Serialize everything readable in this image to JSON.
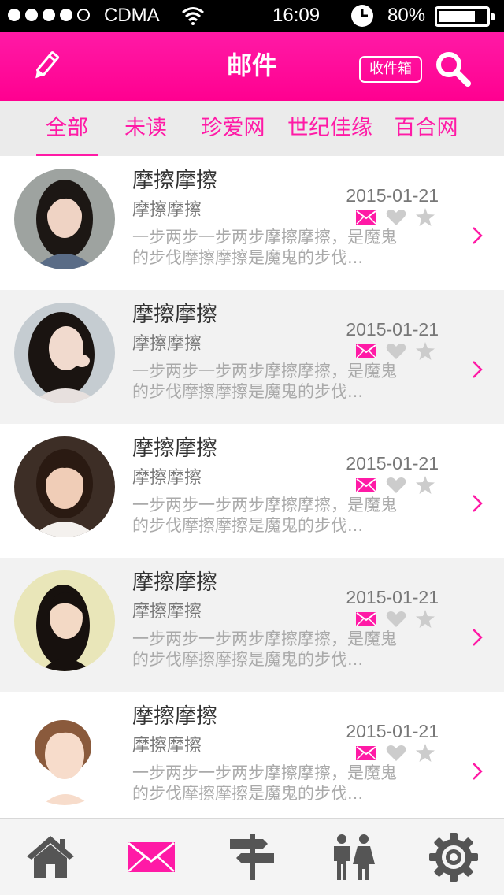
{
  "status_bar": {
    "carrier": "CDMA",
    "time": "16:09",
    "battery": "80%",
    "battery_level": 0.8,
    "signal_bars": 4
  },
  "header": {
    "title": "邮件",
    "inbox_label": "收件箱",
    "edit_icon": "pencil-icon",
    "search_icon": "search-icon"
  },
  "tabs": [
    {
      "label": "全部",
      "active": true
    },
    {
      "label": "未读",
      "active": false
    },
    {
      "label": "珍爱网",
      "active": false
    },
    {
      "label": "世纪佳缘",
      "active": false
    },
    {
      "label": "百合网",
      "active": false
    }
  ],
  "mails": [
    {
      "sender": "摩擦摩擦",
      "subject": "摩擦摩擦",
      "date": "2015-01-21",
      "preview_line1": "一步两步一步两步摩擦摩擦，是魔鬼",
      "preview_line2": "的步伐摩擦摩擦是魔鬼的步伐..."
    },
    {
      "sender": "摩擦摩擦",
      "subject": "摩擦摩擦",
      "date": "2015-01-21",
      "preview_line1": "一步两步一步两步摩擦摩擦，是魔鬼",
      "preview_line2": "的步伐摩擦摩擦是魔鬼的步伐..."
    },
    {
      "sender": "摩擦摩擦",
      "subject": "摩擦摩擦",
      "date": "2015-01-21",
      "preview_line1": "一步两步一步两步摩擦摩擦，是魔鬼",
      "preview_line2": "的步伐摩擦摩擦是魔鬼的步伐..."
    },
    {
      "sender": "摩擦摩擦",
      "subject": "摩擦摩擦",
      "date": "2015-01-21",
      "preview_line1": "一步两步一步两步摩擦摩擦，是魔鬼",
      "preview_line2": "的步伐摩擦摩擦是魔鬼的步伐..."
    },
    {
      "sender": "摩擦摩擦",
      "subject": "摩擦摩擦",
      "date": "2015-01-21",
      "preview_line1": "一步两步一步两步摩擦摩擦，是魔鬼",
      "preview_line2": "的步伐摩擦摩擦是魔鬼的步伐..."
    }
  ],
  "bottom_nav": [
    {
      "icon": "home-icon",
      "active": false
    },
    {
      "icon": "mail-icon",
      "active": true
    },
    {
      "icon": "signpost-icon",
      "active": false
    },
    {
      "icon": "couple-icon",
      "active": false
    },
    {
      "icon": "gear-icon",
      "active": false
    }
  ],
  "colors": {
    "accent": "#ff1aa6",
    "tab_bar": "#ebebeb",
    "alt_row": "#f2f2f2",
    "icon_gray": "#555555",
    "muted_icon": "#cccccc"
  }
}
